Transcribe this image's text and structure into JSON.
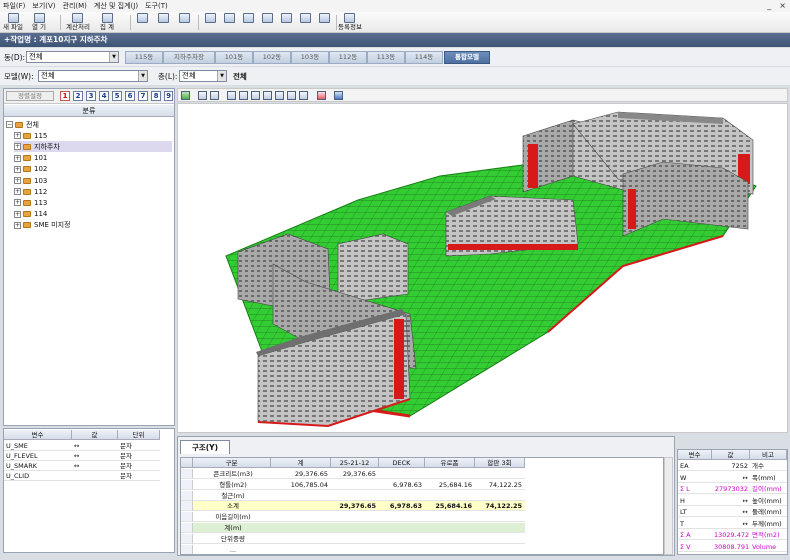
{
  "menu": [
    "파일(F)",
    "보기(V)",
    "관리(M)",
    "계산 및 집계(J)",
    "도구(T)"
  ],
  "window_controls": [
    "_",
    "×"
  ],
  "toolbar": {
    "new_file": "새 파일",
    "open": "열  기",
    "calc": "계산처리",
    "summary": "집  계",
    "register": "등록정보"
  },
  "title_bar": "+작업명 : 계포10지구 지하주차",
  "row1": {
    "dong_label": "동(D):",
    "dong_value": "전체",
    "tabs": [
      "115동",
      "지하주차장",
      "101동",
      "102동",
      "103동",
      "112동",
      "113동",
      "114동",
      "통합모델"
    ]
  },
  "row2": {
    "model_label": "모델(W):",
    "model_value": "전체",
    "floor_label": "층(L):",
    "floor_value": "전체",
    "floor_text": "전체"
  },
  "left_panel": {
    "toolbar_btn": "정렬설정",
    "numbers": [
      "1",
      "2",
      "3",
      "4",
      "5",
      "6",
      "7",
      "8",
      "9"
    ],
    "header": "분류",
    "tree": [
      {
        "label": "전체",
        "level": 0,
        "exp": "−"
      },
      {
        "label": "115",
        "level": 1,
        "exp": "+"
      },
      {
        "label": "지하주차",
        "level": 1,
        "exp": "+",
        "selected": true
      },
      {
        "label": "101",
        "level": 1,
        "exp": "+"
      },
      {
        "label": "102",
        "level": 1,
        "exp": "+"
      },
      {
        "label": "103",
        "level": 1,
        "exp": "+"
      },
      {
        "label": "112",
        "level": 1,
        "exp": "+"
      },
      {
        "label": "113",
        "level": 1,
        "exp": "+"
      },
      {
        "label": "114",
        "level": 1,
        "exp": "+"
      },
      {
        "label": "SME 미지정",
        "level": 1,
        "exp": "+"
      }
    ]
  },
  "var_table": {
    "headers": [
      "변수",
      "값",
      "단위"
    ],
    "rows": [
      {
        "name": "U_SME",
        "value": "↔",
        "unit": "문자"
      },
      {
        "name": "U_FLEVEL",
        "value": "↔",
        "unit": "문자"
      },
      {
        "name": "U_SMARK",
        "value": "↔",
        "unit": "문자"
      },
      {
        "name": "U_CLID",
        "value": "",
        "unit": "문자"
      }
    ]
  },
  "bottom_panel": {
    "tab": "구조(Y)",
    "headers": [
      "구분",
      "계",
      "25-21-12",
      "DECK",
      "유로폼",
      "합판 3회"
    ],
    "rows": [
      {
        "label": "콘크리트(m3)",
        "values": [
          "29,376.65",
          "29,376.65",
          "",
          "",
          ""
        ],
        "style": ""
      },
      {
        "label": "형틀(m2)",
        "values": [
          "106,785.04",
          "",
          "6,978.63",
          "25,684.16",
          "74,122.25"
        ],
        "style": ""
      },
      {
        "label": "철근(m)",
        "values": [
          "",
          "",
          "",
          "",
          ""
        ],
        "style": ""
      },
      {
        "label": "소계",
        "values": [
          "",
          "29,376.65",
          "6,978.63",
          "25,684.16",
          "74,122.25"
        ],
        "style": "yellow"
      },
      {
        "label": "이음길이(m)",
        "values": [
          "",
          "",
          "",
          "",
          ""
        ],
        "style": ""
      },
      {
        "label": "계(m)",
        "values": [
          "",
          "",
          "",
          "",
          ""
        ],
        "style": "green"
      },
      {
        "label": "단위중량",
        "values": [
          "",
          "",
          "",
          "",
          ""
        ],
        "style": ""
      },
      {
        "label": "...",
        "values": [
          "",
          "",
          "",
          "",
          ""
        ],
        "style": ""
      }
    ]
  },
  "prop_table": {
    "headers": [
      "변수",
      "값",
      "비고"
    ],
    "rows": [
      {
        "name": "EA",
        "value": "7252",
        "note": "개수",
        "color": ""
      },
      {
        "name": "W",
        "value": "↔",
        "note": "폭(mm)",
        "color": ""
      },
      {
        "name": "Σ L",
        "value": "27973032",
        "note": "길이(mm)",
        "color": "magenta"
      },
      {
        "name": "H",
        "value": "↔",
        "note": "높이(mm)",
        "color": ""
      },
      {
        "name": "LT",
        "value": "↔",
        "note": "둘레(mm)",
        "color": ""
      },
      {
        "name": "T",
        "value": "↔",
        "note": "두께(mm)",
        "color": ""
      },
      {
        "name": "Σ A",
        "value": "13029.472",
        "note": "면적(m2)",
        "color": "magenta"
      },
      {
        "name": "Σ V",
        "value": "30808.791",
        "note": "Volume",
        "color": "magenta"
      }
    ]
  },
  "colors": {
    "ground": "#2fce2f",
    "highlight": "#d61a1a",
    "building": "#9a9a9a",
    "title_bar": "#4a6184"
  },
  "icons": [
    "new-file-icon",
    "open-icon",
    "zoom-icon",
    "view-icon",
    "table-icon",
    "calc-icon",
    "summary-icon",
    "register-icon"
  ]
}
